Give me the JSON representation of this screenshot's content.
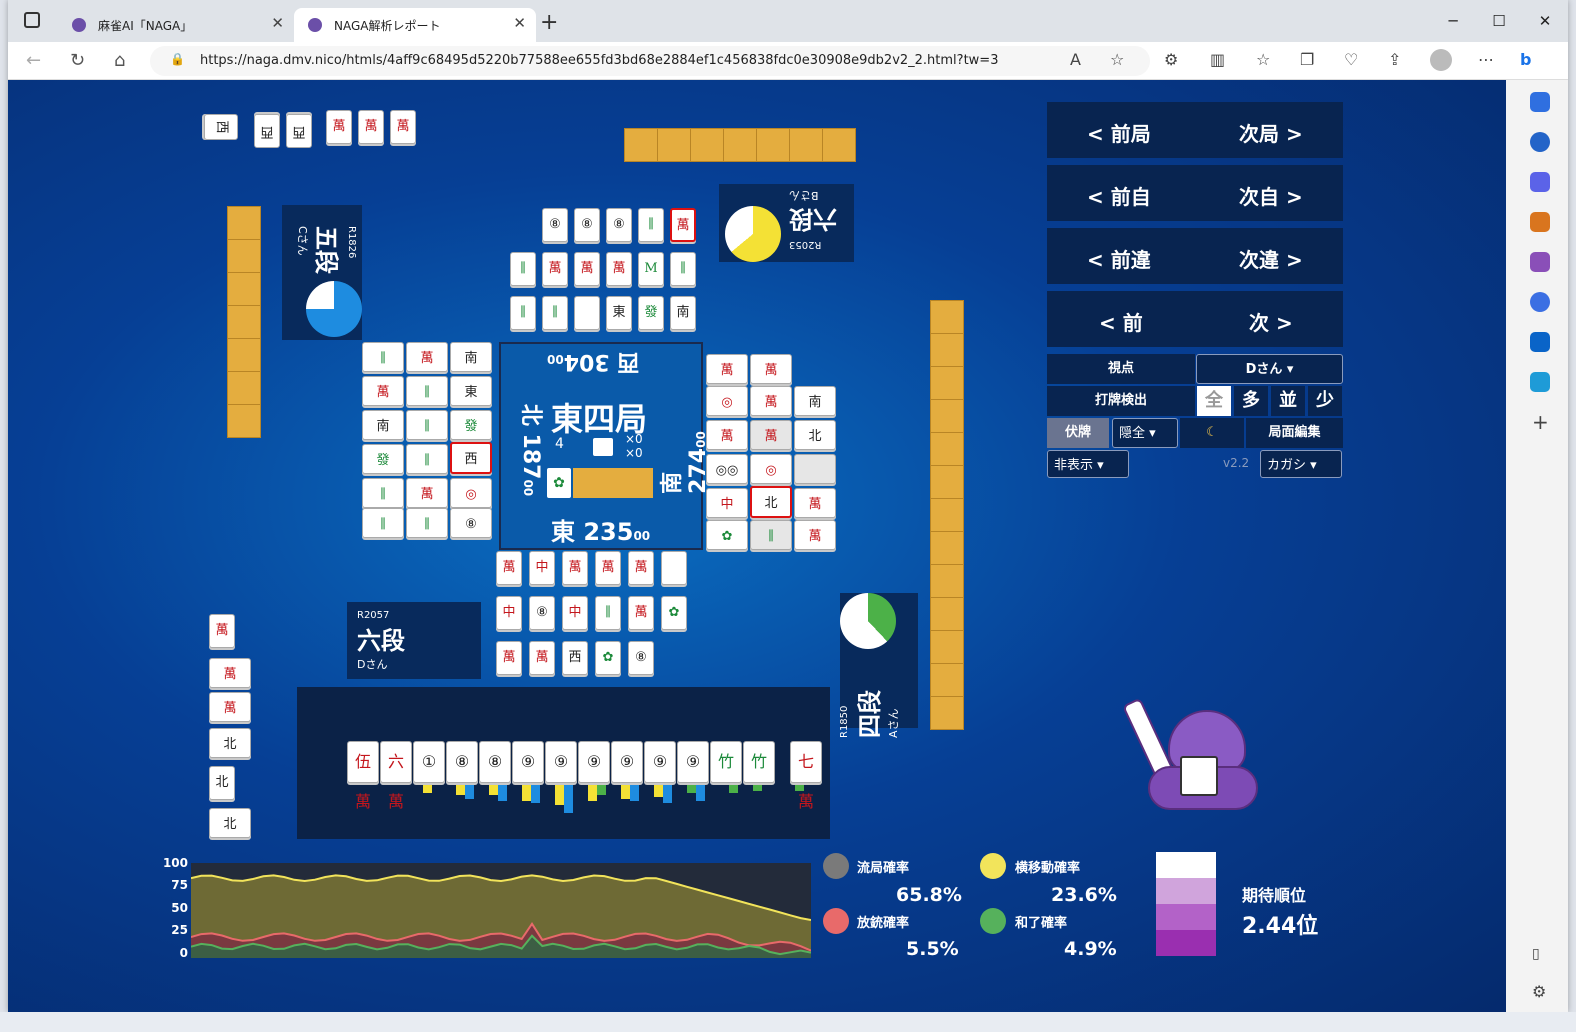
{
  "browser": {
    "tabs": [
      {
        "title": "麻雀AI「NAGA」",
        "active": false
      },
      {
        "title": "NAGA解析レポート",
        "active": true
      }
    ],
    "url": "https://naga.dmv.nico/htmls/4aff9c68495d5220b77588ee655fd3bd68e2884ef1c456838fdc0e30908e9db2v2_2.html?tw=3"
  },
  "center": {
    "round": "東四局",
    "honba": "4",
    "riichi_sticks": "×0",
    "kyotaku": "×0",
    "score_west": "西 304",
    "score_west_sub": "00",
    "score_north": "北 187",
    "score_north_sub": "00",
    "score_south": "南 274",
    "score_south_sub": "00",
    "score_east": "東 235",
    "score_east_sub": "00"
  },
  "players": {
    "top": {
      "rating": "R2053",
      "rank": "六段",
      "name": "Bさん"
    },
    "left": {
      "rating": "R1826",
      "rank": "五段",
      "name": "Cさん"
    },
    "bottom": {
      "rating": "R2057",
      "rank": "六段",
      "name": "Dさん"
    },
    "right": {
      "rating": "R1850",
      "rank": "四段",
      "name": "Aさん"
    }
  },
  "nav": {
    "prev_round": "< 前局",
    "next_round": "次局 >",
    "prev_self": "< 前自",
    "next_self": "次自 >",
    "prev_diff": "< 前違",
    "next_diff": "次違 >",
    "prev": "< 前",
    "next": "次 >"
  },
  "controls": {
    "viewpoint_label": "視点",
    "viewpoint_value": "Dさん",
    "discard_check_label": "打牌検出",
    "discard_options": [
      "全",
      "多",
      "並",
      "少"
    ],
    "fuhai_label": "伏牌",
    "fuhai_value": "隠全",
    "moon_icon": "☾",
    "edit_label": "局面編集",
    "hide_value": "非表示",
    "version": "v2.2",
    "lang_value": "カガシ"
  },
  "hand": {
    "tiles": [
      "伍萬",
      "六萬",
      "①",
      "⑧",
      "⑧",
      "⑨",
      "⑨",
      "⑨",
      "⑨",
      "⑨",
      "⑨",
      "竹",
      "竹"
    ],
    "tsumo": "七萬"
  },
  "graph": {
    "y_ticks": [
      "100",
      "75",
      "50",
      "25",
      "0"
    ],
    "series": [
      {
        "name": "流局確率",
        "value": "65.8%",
        "color": "#7a7a7a"
      },
      {
        "name": "横移動確率",
        "value": "23.6%",
        "color": "#f2e45b"
      },
      {
        "name": "放銃確率",
        "value": "5.5%",
        "color": "#e86a6a"
      },
      {
        "name": "和了確率",
        "value": "4.9%",
        "color": "#56b15c"
      }
    ],
    "expected_rank_label": "期待順位",
    "expected_rank_value": "2.44位"
  }
}
